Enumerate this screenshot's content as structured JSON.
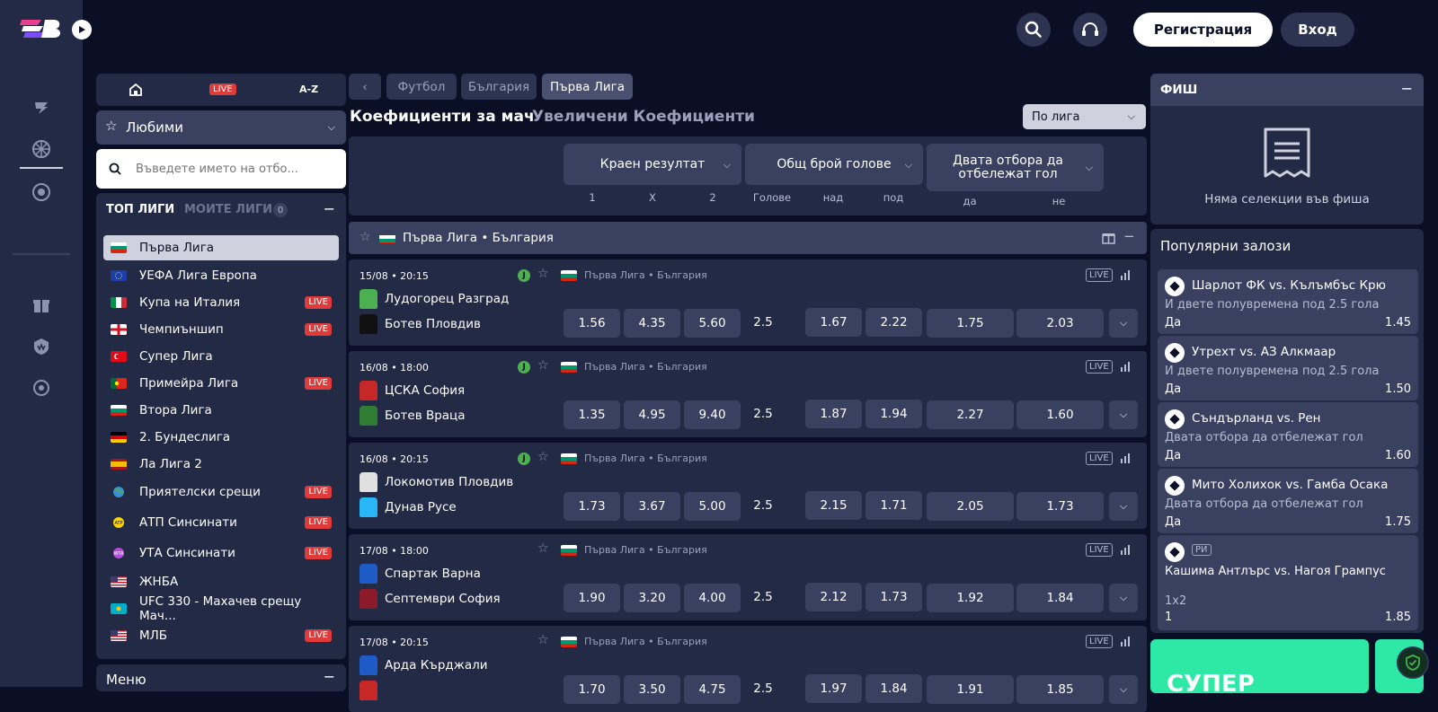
{
  "header": {
    "register_label": "Регистрация",
    "login_label": "Вход"
  },
  "left": {
    "tabs": {
      "live": "LIVE",
      "az": "A-Z"
    },
    "favorites_label": "Любими",
    "search_placeholder": "Въведете името на отбо...",
    "top_leagues_label": "ТОП ЛИГИ",
    "my_leagues_label": "МОИТЕ ЛИГИ",
    "my_leagues_count": "0",
    "menu_label": "Меню",
    "leagues": [
      {
        "name": "Първа Лига",
        "live": "",
        "flag": "bg"
      },
      {
        "name": "УЕФА Лига Европа",
        "live": "",
        "flag": "eu"
      },
      {
        "name": "Купа на Италия",
        "live": "LIVE",
        "flag": "it"
      },
      {
        "name": "Чемпиъншип",
        "live": "LIVE",
        "flag": "en"
      },
      {
        "name": "Супер Лига",
        "live": "",
        "flag": "tr"
      },
      {
        "name": "Примейра Лига",
        "live": "LIVE",
        "flag": "pt"
      },
      {
        "name": "Втора Лига",
        "live": "",
        "flag": "bg"
      },
      {
        "name": "2. Бундеслига",
        "live": "",
        "flag": "de"
      },
      {
        "name": "Ла Лига 2",
        "live": "",
        "flag": "es"
      },
      {
        "name": "Приятелски срещи",
        "live": "LIVE",
        "flag": "world"
      },
      {
        "name": "АТП Синсинати",
        "live": "LIVE",
        "flag": "atp"
      },
      {
        "name": "УТА Синсинати",
        "live": "LIVE",
        "flag": "wta"
      },
      {
        "name": "ЖНБА",
        "live": "",
        "flag": "us"
      },
      {
        "name": "UFC 330 - Махачев срещу Мач...",
        "live": "",
        "flag": "kz"
      },
      {
        "name": "МЛБ",
        "live": "LIVE",
        "flag": "us"
      }
    ]
  },
  "main": {
    "breadcrumbs": [
      "Футбол",
      "България",
      "Първа Лига"
    ],
    "title_active": "Коефициенти за мач",
    "title_inactive": "Увеличени Коефициенти",
    "sort_label": "По лига",
    "markets": [
      {
        "label": "Краен резултат",
        "subs": [
          "1",
          "X",
          "2"
        ]
      },
      {
        "label": "Общ брой голове",
        "subs": [
          "Голове",
          "над",
          "под"
        ]
      },
      {
        "label": "Двата отбора да отбележат гол",
        "subs": [
          "да",
          "не"
        ]
      }
    ],
    "league_header": "Първа Лига • България",
    "matches": [
      {
        "time": "15/08 • 20:15",
        "home": "Лудогорец Разград",
        "away": "Ботев Пловдив",
        "league": "Първа Лига • България",
        "live": "LIVE",
        "o1": "1.56",
        "ox": "4.35",
        "o2": "5.60",
        "line": "2.5",
        "over": "1.67",
        "under": "2.22",
        "yes": "1.75",
        "no": "2.03",
        "home_color": "#4caf50",
        "away_color": "#111111"
      },
      {
        "time": "16/08 • 18:00",
        "home": "ЦСКА София",
        "away": "Ботев Враца",
        "league": "Първа Лига • България",
        "live": "LIVE",
        "o1": "1.35",
        "ox": "4.95",
        "o2": "9.40",
        "line": "2.5",
        "over": "1.87",
        "under": "1.94",
        "yes": "2.27",
        "no": "1.60",
        "home_color": "#c62828",
        "away_color": "#2e7d32"
      },
      {
        "time": "16/08 • 20:15",
        "home": "Локомотив Пловдив",
        "away": "Дунав Русе",
        "league": "Първа Лига • България",
        "live": "LIVE",
        "o1": "1.73",
        "ox": "3.67",
        "o2": "5.00",
        "line": "2.5",
        "over": "2.15",
        "under": "1.71",
        "yes": "2.05",
        "no": "1.73",
        "home_color": "#e0e0e0",
        "away_color": "#29b6f6"
      },
      {
        "time": "17/08 • 18:00",
        "home": "Спартак Варна",
        "away": "Септември София",
        "league": "Първа Лига • България",
        "live": "LIVE",
        "o1": "1.90",
        "ox": "3.20",
        "o2": "4.00",
        "line": "2.5",
        "over": "2.12",
        "under": "1.73",
        "yes": "1.92",
        "no": "1.84",
        "home_color": "#1e5bc6",
        "away_color": "#8b1a2b"
      },
      {
        "time": "17/08 • 20:15",
        "home": "Арда Кърджали",
        "away": "",
        "league": "Първа Лига • България",
        "live": "LIVE",
        "o1": "1.70",
        "ox": "3.50",
        "o2": "4.75",
        "line": "2.5",
        "over": "1.97",
        "under": "1.84",
        "yes": "1.91",
        "no": "1.85",
        "home_color": "#1e5bc6",
        "away_color": "#c62828"
      }
    ]
  },
  "right": {
    "slip_label": "ФИШ",
    "empty_label": "Няма селекции във фиша",
    "popular_label": "Популярни залози",
    "popular": [
      {
        "title": "Шарлот ФК vs. Кълъмбъс Крю",
        "desc": "И двете полувремена под 2.5 гола",
        "pick": "Да",
        "odd": "1.45"
      },
      {
        "title": "Утрехт vs. АЗ Алкмаар",
        "desc": "И двете полувремена под 2.5 гола",
        "pick": "Да",
        "odd": "1.50"
      },
      {
        "title": "Съндърланд vs. Рен",
        "desc": "Двата отбора да отбележат гол",
        "pick": "Да",
        "odd": "1.60"
      },
      {
        "title": "Мито Холихок vs. Гамба Осака",
        "desc": "Двата отбора да отбележат гол",
        "pick": "Да",
        "odd": "1.75"
      },
      {
        "title": "Кашима Антлърс vs. Нагоя Грампус",
        "tag": "РИ",
        "desc": "1x2",
        "pick": "1",
        "odd": "1.85"
      }
    ],
    "promo_text": "СУПЕР"
  }
}
